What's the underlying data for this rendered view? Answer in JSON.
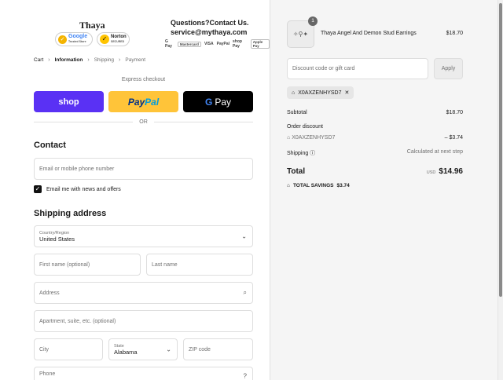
{
  "header": {
    "brand": "Thaya",
    "google_badge": {
      "label": "Google",
      "sub": "Trusted Store"
    },
    "norton_badge": {
      "label": "Norton",
      "sub": "SECURED"
    },
    "contact_question": "Questions?Contact Us.",
    "contact_email": "service@mythaya.com",
    "payment_methods": [
      "G Pay",
      "Mastercard",
      "VISA",
      "PayPal",
      "shop Pay",
      "Apple Pay"
    ]
  },
  "breadcrumb": {
    "items": [
      {
        "label": "Cart",
        "state": "link"
      },
      {
        "label": "Information",
        "state": "current"
      },
      {
        "label": "Shipping",
        "state": "upcoming"
      },
      {
        "label": "Payment",
        "state": "upcoming"
      }
    ]
  },
  "express": {
    "label": "Express checkout",
    "shop_label": "shop",
    "paypal_label_1": "Pay",
    "paypal_label_2": "Pal",
    "gpay_label": "Pay",
    "or_label": "OR"
  },
  "contact": {
    "title": "Contact",
    "email_placeholder": "Email or mobile phone number",
    "newsletter_label": "Email me with news and offers",
    "newsletter_checked": true
  },
  "shipping": {
    "title": "Shipping address",
    "country_label": "Country/Region",
    "country_value": "United States",
    "first_name_placeholder": "First name (optional)",
    "last_name_placeholder": "Last name",
    "address_placeholder": "Address",
    "apartment_placeholder": "Apartment, suite, etc. (optional)",
    "city_placeholder": "City",
    "state_label": "State",
    "state_value": "Alabama",
    "zip_placeholder": "ZIP code",
    "phone_placeholder": "Phone"
  },
  "summary": {
    "item": {
      "name": "Thaya Angel And Demon Stud Earrings",
      "price": "$18.70",
      "quantity": "1"
    },
    "discount_placeholder": "Discount code or gift card",
    "apply_label": "Apply",
    "applied_code": "X0AXZENHYSD7",
    "subtotal_label": "Subtotal",
    "subtotal_value": "$18.70",
    "order_discount_label": "Order discount",
    "discount_code": "X0AXZENHYSD7",
    "discount_value": "– $3.74",
    "shipping_label": "Shipping",
    "shipping_value": "Calculated at next step",
    "total_label": "Total",
    "currency": "USD",
    "total_value": "$14.96",
    "savings_label": "TOTAL SAVINGS",
    "savings_value": "$3.74"
  },
  "colors": {
    "shop_purple": "#5a31f4",
    "paypal_yellow": "#ffc439",
    "gpay_black": "#000000",
    "summary_bg": "#f5f5f5"
  }
}
